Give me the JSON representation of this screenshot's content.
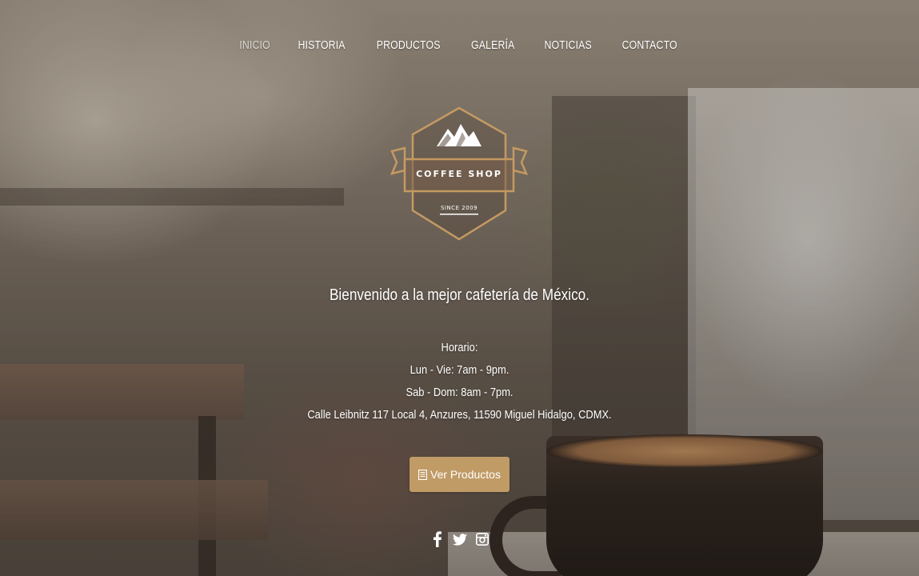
{
  "nav": {
    "items": [
      {
        "label": "INICIO",
        "active": true
      },
      {
        "label": "HISTORIA"
      },
      {
        "label": "PRODUCTOS"
      },
      {
        "label": "GALERÍA"
      },
      {
        "label": "NOTICIAS"
      },
      {
        "label": "CONTACTO"
      }
    ]
  },
  "logo": {
    "title": "COFFEE SHOP",
    "since": "SINCE 2009"
  },
  "hero": {
    "welcome": "Bienvenido a la mejor cafetería de México.",
    "hours_title": "Horario:",
    "weekdays": "Lun - Vie: 7am - 9pm.",
    "weekend": "Sab - Dom: 8am - 7pm.",
    "address": "Calle Leibnitz 117 Local 4, Anzures, 11590 Miguel Hidalgo, CDMX."
  },
  "cta": {
    "label": "Ver Productos",
    "icon": "document-icon"
  },
  "social": [
    "facebook-icon",
    "twitter-icon",
    "instagram-icon"
  ],
  "colors": {
    "accent": "#c09b66",
    "logo_gold": "#c49a62"
  }
}
